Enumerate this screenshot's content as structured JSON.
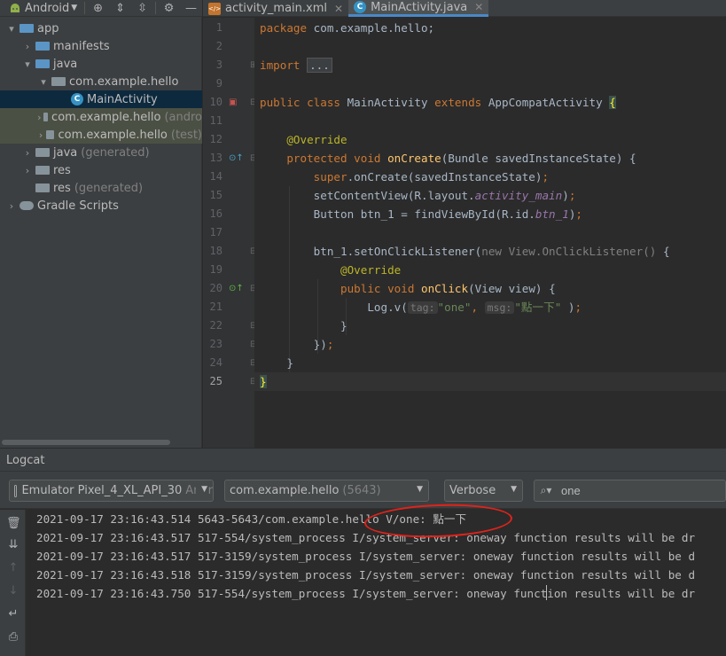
{
  "project_panel": {
    "view_label": "Android",
    "tree": [
      {
        "label": "app",
        "suffix": "",
        "depth": 0,
        "expanded": true,
        "icon": "module-folder-icon"
      },
      {
        "label": "manifests",
        "suffix": "",
        "depth": 1,
        "expanded": false,
        "icon": "folder-icon"
      },
      {
        "label": "java",
        "suffix": "",
        "depth": 1,
        "expanded": true,
        "icon": "source-folder-icon"
      },
      {
        "label": "com.example.hello",
        "suffix": "",
        "depth": 2,
        "expanded": true,
        "icon": "package-icon"
      },
      {
        "label": "MainActivity",
        "suffix": "",
        "depth": 3,
        "expanded": null,
        "icon": "class-icon"
      },
      {
        "label": "com.example.hello",
        "suffix": "(andro",
        "depth": 2,
        "expanded": false,
        "icon": "package-icon"
      },
      {
        "label": "com.example.hello",
        "suffix": "(test)",
        "depth": 2,
        "expanded": false,
        "icon": "package-icon"
      },
      {
        "label": "java",
        "suffix": "(generated)",
        "depth": 1,
        "expanded": false,
        "icon": "generated-source-folder-icon"
      },
      {
        "label": "res",
        "suffix": "",
        "depth": 1,
        "expanded": false,
        "icon": "resource-folder-icon"
      },
      {
        "label": "res",
        "suffix": "(generated)",
        "depth": 1,
        "expanded": null,
        "icon": "resource-folder-icon"
      },
      {
        "label": "Gradle Scripts",
        "suffix": "",
        "depth": 0,
        "expanded": false,
        "icon": "gradle-icon"
      }
    ]
  },
  "editor": {
    "tabs": [
      {
        "label": "activity_main.xml",
        "icon": "xml-file-icon",
        "active": false
      },
      {
        "label": "MainActivity.java",
        "icon": "class-icon",
        "active": true
      }
    ],
    "current_line": 25,
    "line_numbers": [
      "1",
      "2",
      "3",
      "9",
      "10",
      "11",
      "12",
      "13",
      "14",
      "15",
      "16",
      "17",
      "18",
      "19",
      "20",
      "21",
      "22",
      "23",
      "24",
      "25"
    ],
    "code": {
      "l1_pkg_kw": "package",
      "l1_pkg_name": " com.example.hello;",
      "l3_import_kw": "import",
      "l3_fold": "...",
      "l10_public": "public class",
      "l10_name": " MainActivity ",
      "l10_extends": "extends",
      "l10_super": " AppCompatActivity ",
      "l10_brace": "{",
      "l12_override": "@Override",
      "l13_mods": "protected void",
      "l13_name": " onCreate",
      "l13_rest": "(Bundle savedInstanceState) {",
      "l14_super": "super",
      "l14_rest": ".onCreate(savedInstanceState)",
      "l14_semi": ";",
      "l15_a": "setContentView(R.layout.",
      "l15_b": "activity_main",
      "l15_c": ")",
      "l15_semi": ";",
      "l16_a": "Button btn_1 = findViewById(R.id.",
      "l16_b": "btn_1",
      "l16_c": ")",
      "l16_semi": ";",
      "l18_a": "btn_1.setOnClickListener(",
      "l18_b": "new View.OnClickListener()",
      "l18_c": " {",
      "l19_override": "@Override",
      "l20_mods": "public void",
      "l20_name": " onClick",
      "l20_rest": "(View view) {",
      "l21_a": "Log.v(",
      "l21_hint_tag": "tag:",
      "l21_tag": "\"one\"",
      "l21_comma": ", ",
      "l21_hint_msg": "msg:",
      "l21_msg": "\"點一下\"",
      "l21_end": " )",
      "l21_semi": ";",
      "l22": "}",
      "l23_a": "})",
      "l23_semi": ";",
      "l24": "}",
      "l25": "}"
    }
  },
  "logcat": {
    "title": "Logcat",
    "device": {
      "label": "Emulator Pixel_4_XL_API_30",
      "suffix": "Andr"
    },
    "process": {
      "label": "com.example.hello",
      "suffix": "(5643)"
    },
    "level": "Verbose",
    "search_value": "one",
    "lines": [
      "2021-09-17 23:16:43.514 5643-5643/com.example.hello V/one: 點一下",
      "2021-09-17 23:16:43.517 517-554/system_process I/system_server: oneway function results will be dr",
      "2021-09-17 23:16:43.517 517-3159/system_process I/system_server: oneway function results will be d",
      "2021-09-17 23:16:43.518 517-3159/system_process I/system_server: oneway function results will be d",
      "2021-09-17 23:16:43.750 517-554/system_process I/system_server: oneway function results will be dr"
    ]
  },
  "colors": {
    "keyword": "#cc7832",
    "annotation": "#bbb529",
    "method": "#ffc66d",
    "string": "#6a8759",
    "field": "#9876aa",
    "selection": "#0d293e",
    "highlight_circle": "#e0231b"
  }
}
